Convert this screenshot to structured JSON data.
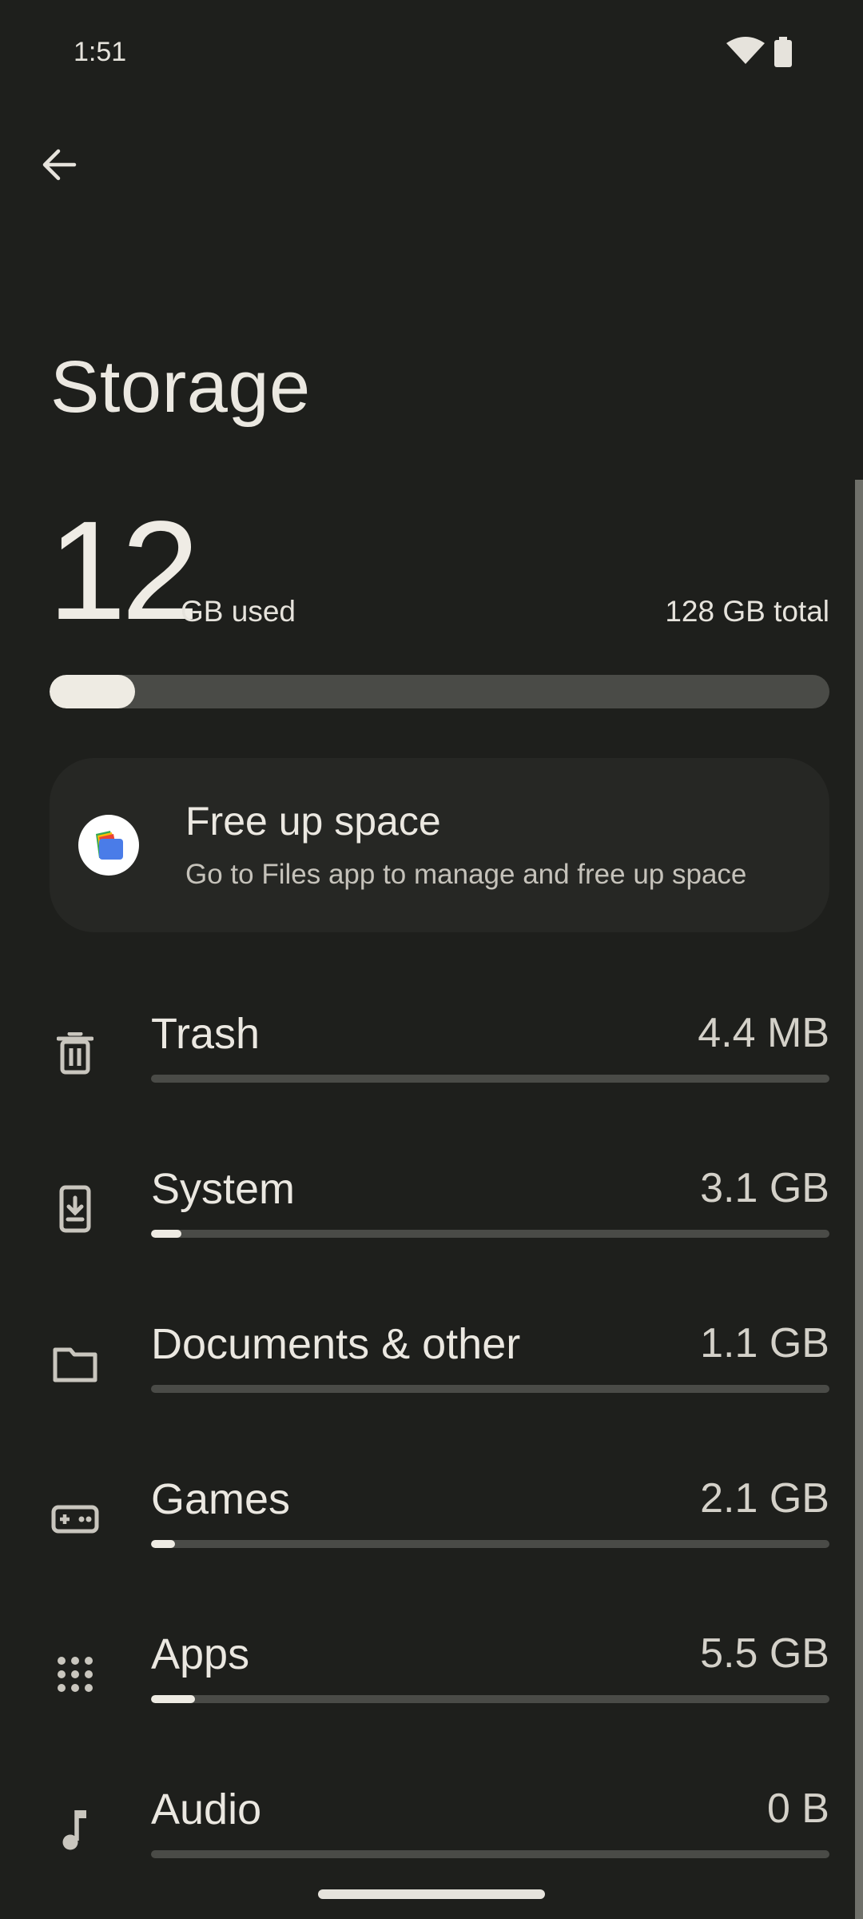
{
  "status_bar": {
    "time": "1:51",
    "icons": [
      "wifi-icon",
      "battery-icon"
    ]
  },
  "header": {
    "back_icon": "arrow-back-icon",
    "title": "Storage"
  },
  "usage": {
    "used_value": "12",
    "used_unit": "GB used",
    "total": "128 GB total",
    "used_fraction": 0.11
  },
  "free_up_card": {
    "icon": "files-app-icon",
    "title": "Free up space",
    "subtitle": "Go to Files app to manage and free up space"
  },
  "categories": [
    {
      "icon": "trash-icon",
      "label": "Trash",
      "size": "4.4 MB",
      "fraction": 0.0
    },
    {
      "icon": "system-icon",
      "label": "System",
      "size": "3.1 GB",
      "fraction": 0.045
    },
    {
      "icon": "folder-icon",
      "label": "Documents & other",
      "size": "1.1 GB",
      "fraction": 0.0
    },
    {
      "icon": "gamepad-icon",
      "label": "Games",
      "size": "2.1 GB",
      "fraction": 0.035
    },
    {
      "icon": "apps-grid-icon",
      "label": "Apps",
      "size": "5.5 GB",
      "fraction": 0.065
    },
    {
      "icon": "music-note-icon",
      "label": "Audio",
      "size": "0 B",
      "fraction": 0.0
    }
  ],
  "colors": {
    "background": "#1e1f1c",
    "card": "#262724",
    "track": "#4a4b47",
    "fill": "#eeebe3",
    "text": "#ebe8e1"
  }
}
